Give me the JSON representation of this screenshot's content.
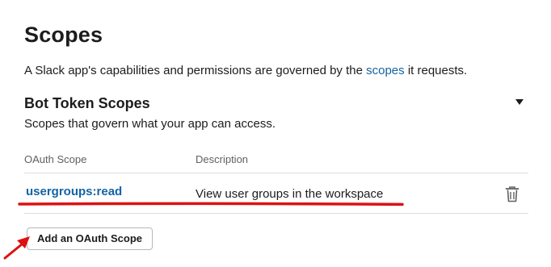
{
  "page": {
    "title": "Scopes",
    "intro_before": "A Slack app's capabilities and permissions are governed by the",
    "intro_link": "scopes",
    "intro_after": "it requests."
  },
  "section": {
    "title": "Bot Token Scopes",
    "subtitle": "Scopes that govern what your app can access."
  },
  "table": {
    "columns": [
      "OAuth Scope",
      "Description"
    ],
    "rows": [
      {
        "scope": "usergroups:read",
        "description": "View user groups in the workspace"
      }
    ]
  },
  "buttons": {
    "add_scope": "Add an OAuth Scope"
  },
  "icons": {
    "delete": "trash-icon",
    "collapse": "caret-down-icon",
    "annotation_arrow": "arrow-icon"
  },
  "colors": {
    "link": "#1264a3",
    "annotation": "#dd1111"
  }
}
